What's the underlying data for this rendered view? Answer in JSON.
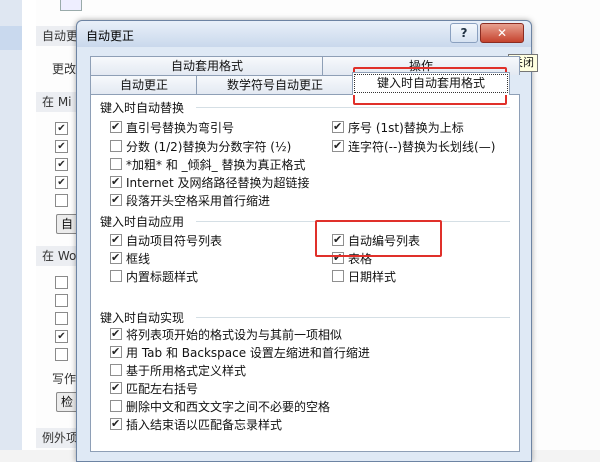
{
  "dialog": {
    "title": "自动更正",
    "help_label": "?",
    "close_label": "✕",
    "tooltip": "关闭"
  },
  "tabs": {
    "row_back": [
      "自动套用格式",
      "操作"
    ],
    "row_front": [
      "自动更正",
      "数学符号自动更正",
      "键入时自动套用格式"
    ]
  },
  "groups": {
    "replace_title": "键入时自动替换",
    "apply_title": "键入时自动应用",
    "implement_title": "键入时自动实现"
  },
  "replace_options": [
    {
      "label": "直引号替换为弯引号",
      "checked": true
    },
    {
      "label": "分数 (1/2)替换为分数字符 (½)",
      "checked": false
    },
    {
      "label": "*加粗* 和 _倾斜_ 替换为真正格式",
      "checked": false
    },
    {
      "label": "Internet 及网络路径替换为超链接",
      "checked": true
    },
    {
      "label": "段落开头空格采用首行缩进",
      "checked": true
    }
  ],
  "replace_options_right": [
    {
      "label": "序号 (1st)替换为上标",
      "checked": true
    },
    {
      "label": "连字符(--)替换为长划线(—)",
      "checked": true
    }
  ],
  "apply_options": [
    {
      "label": "自动项目符号列表",
      "checked": true
    },
    {
      "label": "框线",
      "checked": true
    },
    {
      "label": "内置标题样式",
      "checked": false
    }
  ],
  "apply_options_right": [
    {
      "label": "自动编号列表",
      "checked": true
    },
    {
      "label": "表格",
      "checked": true
    },
    {
      "label": "日期样式",
      "checked": false
    }
  ],
  "implement_options": [
    {
      "label": "将列表项开始的格式设为与其前一项相似",
      "checked": true
    },
    {
      "label": "用 Tab 和 Backspace 设置左缩进和首行缩进",
      "checked": true
    },
    {
      "label": "基于所用格式定义样式",
      "checked": false
    },
    {
      "label": "匹配左右括号",
      "checked": true
    },
    {
      "label": "删除中文和西文文字之间不必要的空格",
      "checked": false
    },
    {
      "label": "插入结束语以匹配备忘录样式",
      "checked": true
    }
  ],
  "background": {
    "section_1": "自动更",
    "line_1": "更改",
    "section_2": "在 Mi",
    "button_1": "自",
    "section_3": "在 Wo",
    "line_2": "写作",
    "button_2": "检",
    "section_4": "例外项"
  },
  "colors": {
    "highlight": "#e0302a",
    "dialog_bg": "#dfe9f5"
  }
}
